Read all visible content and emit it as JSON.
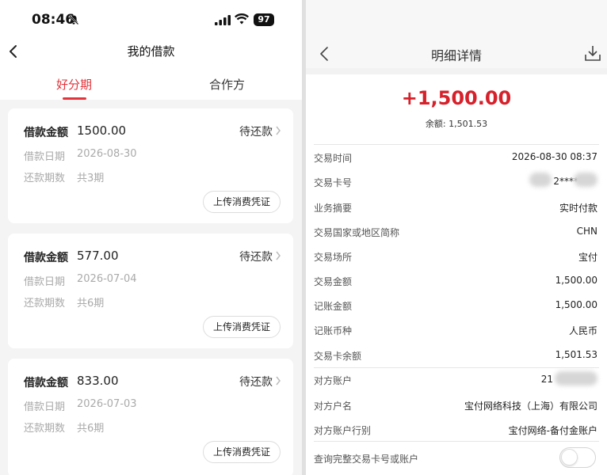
{
  "left": {
    "status_bar": {
      "time": "08:46",
      "battery": "97"
    },
    "nav": {
      "title": "我的借款"
    },
    "tabs": [
      {
        "label": "好分期",
        "active": true
      },
      {
        "label": "合作方",
        "active": false
      }
    ],
    "loans": [
      {
        "amount_label": "借款金额",
        "amount": "1500.00",
        "status": "待还款",
        "date_label": "借款日期",
        "date": "2026-08-30",
        "periods_label": "还款期数",
        "periods": "共3期",
        "button": "上传消费凭证"
      },
      {
        "amount_label": "借款金额",
        "amount": "577.00",
        "status": "待还款",
        "date_label": "借款日期",
        "date": "2026-07-04",
        "periods_label": "还款期数",
        "periods": "共6期",
        "button": "上传消费凭证"
      },
      {
        "amount_label": "借款金额",
        "amount": "833.00",
        "status": "待还款",
        "date_label": "借款日期",
        "date": "2026-07-03",
        "periods_label": "还款期数",
        "periods": "共6期",
        "button": "上传消费凭证"
      }
    ]
  },
  "right": {
    "nav": {
      "title": "明细详情"
    },
    "amount": "+1,500.00",
    "balance": "余额: 1,501.53",
    "rows": [
      {
        "key": "交易时间",
        "value": "2026-08-30 08:37"
      },
      {
        "key": "交易卡号",
        "value": "2****"
      },
      {
        "key": "业务摘要",
        "value": "实时付款"
      },
      {
        "key": "交易国家或地区简称",
        "value": "CHN"
      },
      {
        "key": "交易场所",
        "value": "宝付"
      },
      {
        "key": "交易金额",
        "value": "1,500.00"
      },
      {
        "key": "记账金额",
        "value": "1,500.00"
      },
      {
        "key": "记账币种",
        "value": "人民币"
      },
      {
        "key": "交易卡余额",
        "value": "1,501.53"
      },
      {
        "key": "对方账户",
        "value": "21"
      },
      {
        "key": "对方户名",
        "value": "宝付网络科技（上海）有限公司"
      },
      {
        "key": "对方账户行别",
        "value": "宝付网络-备付金账户"
      },
      {
        "key": "查询完整交易卡号或账户",
        "value": ""
      }
    ],
    "toggle_on": false
  },
  "colors": {
    "accent": "#e2343b",
    "amount_red": "#d6212b"
  }
}
